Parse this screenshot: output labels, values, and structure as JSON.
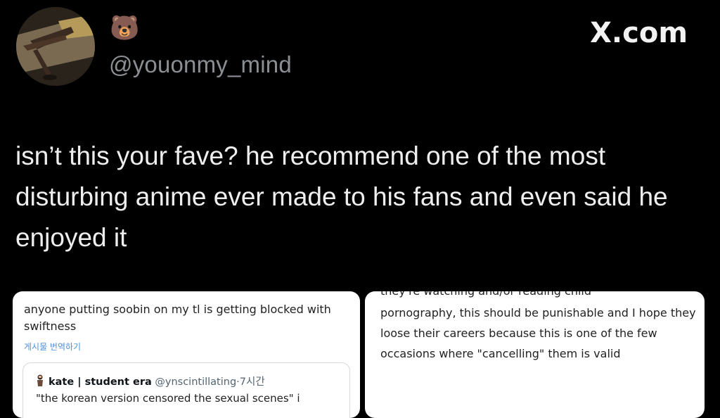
{
  "header": {
    "display_emoji": "🐻",
    "handle": "@youonmy_mind",
    "brand": "X.com"
  },
  "post": {
    "text": "isn’t this your fave? he recommend one of the most disturbing anime ever made to his fans and even said he enjoyed it"
  },
  "embedded_left": {
    "text": "anyone putting soobin on my tl is getting blocked with swiftness",
    "translate_label": "게시물 번역하기",
    "quote": {
      "name": "kate | student era",
      "handle": "@ynscintillating",
      "separator": "·",
      "time": "7시간",
      "body": "\"the korean version censored the sexual scenes\" i"
    }
  },
  "embedded_right": {
    "cut_line": "they're watching and/or reading child",
    "text": "pornography, this should be punishable and I hope they loose their careers because this is one of the few occasions where \"cancelling\" them is valid"
  }
}
